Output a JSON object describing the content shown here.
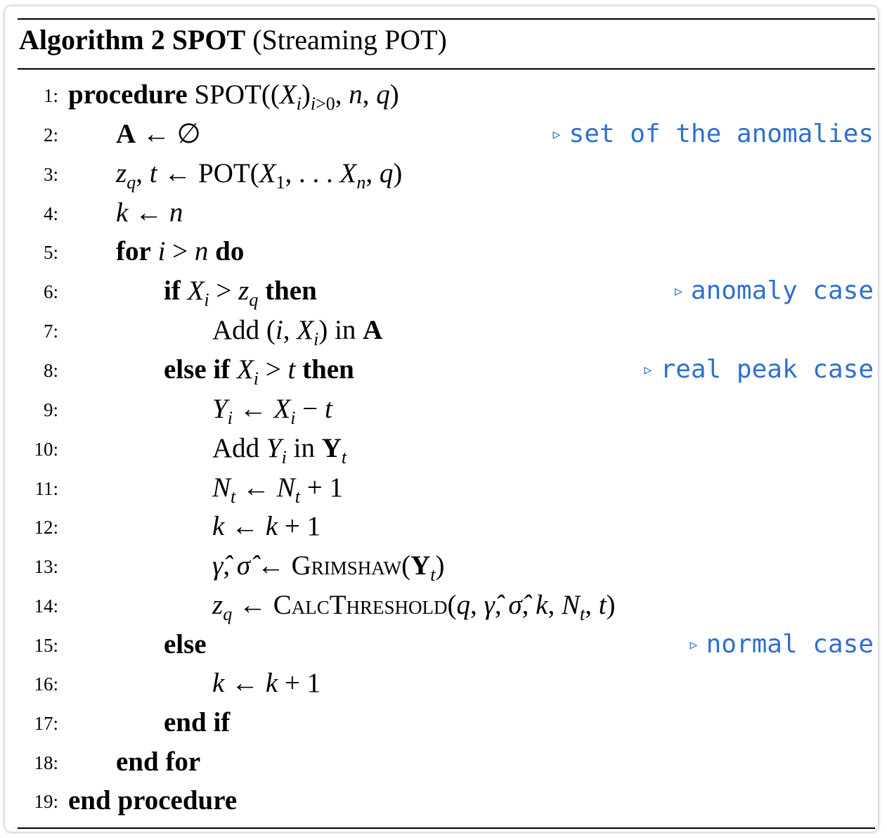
{
  "title": {
    "bold": "Algorithm 2 SPOT",
    "rest": "(Streaming POT)"
  },
  "lines": [
    {
      "n": "1:",
      "text": ""
    },
    {
      "n": "2:",
      "comment": "set of the anomalies"
    },
    {
      "n": "3:"
    },
    {
      "n": "4:"
    },
    {
      "n": "5:"
    },
    {
      "n": "6:",
      "comment": "anomaly case"
    },
    {
      "n": "7:"
    },
    {
      "n": "8:",
      "comment": "real peak case"
    },
    {
      "n": "9:"
    },
    {
      "n": "10:"
    },
    {
      "n": "11:"
    },
    {
      "n": "12:"
    },
    {
      "n": "13:"
    },
    {
      "n": "14:"
    },
    {
      "n": "15:",
      "comment": "normal case"
    },
    {
      "n": "16:"
    },
    {
      "n": "17:"
    },
    {
      "n": "18:"
    },
    {
      "n": "19:"
    }
  ],
  "keywords": {
    "procedure": "procedure",
    "for": "for",
    "do": "do",
    "if": "if",
    "then": "then",
    "else_if": "else if",
    "else": "else",
    "end_if": "end if",
    "end_for": "end for",
    "end_procedure": "end procedure",
    "add": "Add",
    "in": "in"
  },
  "functions": {
    "spot": "SPOT",
    "pot": "POT",
    "grimshaw": "Grimshaw",
    "calc": "CalcThreshold"
  },
  "comment_marker": "▹",
  "colors": {
    "comment": "#2f6fd0",
    "text": "#000000"
  }
}
